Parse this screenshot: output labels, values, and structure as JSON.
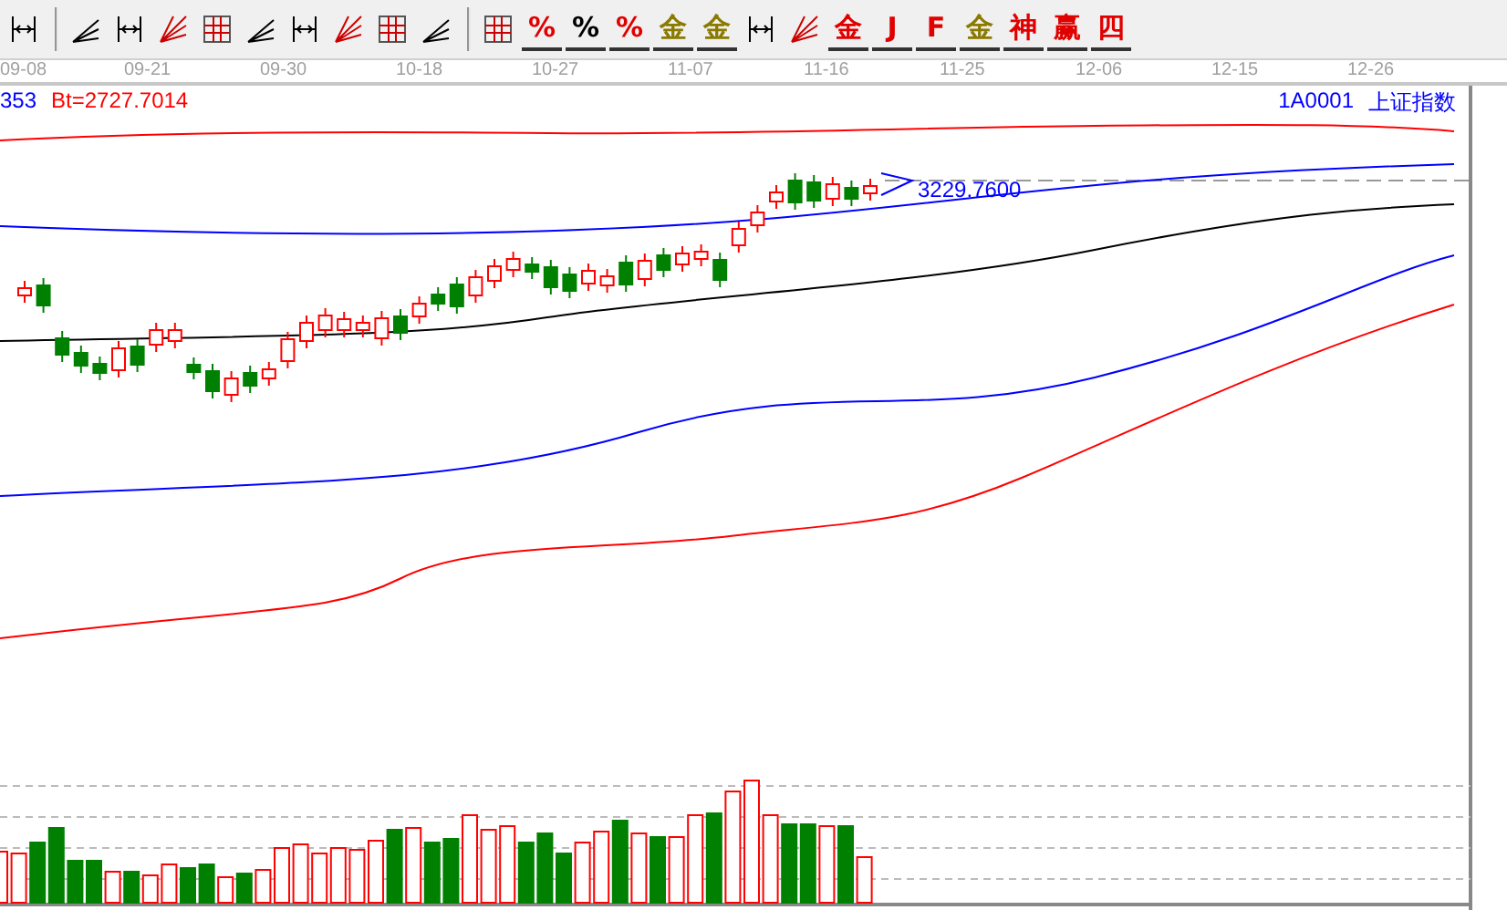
{
  "toolbar": {
    "groups": [
      [
        {
          "kind": "icon"
        }
      ],
      [
        {
          "kind": "icon"
        },
        {
          "kind": "icon"
        },
        {
          "kind": "icon"
        },
        {
          "kind": "icon"
        },
        {
          "kind": "icon"
        },
        {
          "kind": "icon"
        },
        {
          "kind": "icon"
        },
        {
          "kind": "icon"
        },
        {
          "kind": "icon"
        }
      ],
      [
        {
          "kind": "icon"
        },
        {
          "kind": "glyph",
          "text": "%",
          "color": "#e00000"
        },
        {
          "kind": "glyph",
          "text": "%",
          "color": "#000000"
        },
        {
          "kind": "glyph",
          "text": "%",
          "color": "#e00000"
        },
        {
          "kind": "glyph",
          "text": "金",
          "color": "#8a7a00"
        },
        {
          "kind": "glyph",
          "text": "金",
          "color": "#8a7a00"
        },
        {
          "kind": "icon"
        },
        {
          "kind": "icon"
        },
        {
          "kind": "glyph",
          "text": "金",
          "color": "#e00000"
        },
        {
          "kind": "glyph",
          "text": "J",
          "color": "#e00000"
        },
        {
          "kind": "glyph",
          "text": "F",
          "color": "#e00000"
        },
        {
          "kind": "glyph",
          "text": "金",
          "color": "#8a7a00"
        },
        {
          "kind": "glyph",
          "text": "神",
          "color": "#e00000"
        },
        {
          "kind": "glyph",
          "text": "赢",
          "color": "#e00000"
        },
        {
          "kind": "glyph",
          "text": "四",
          "color": "#e00000"
        }
      ]
    ]
  },
  "date_axis": {
    "labels": [
      "09-08",
      "09-21",
      "09-30",
      "10-18",
      "10-27",
      "11-07",
      "11-16",
      "11-25",
      "12-06",
      "12-15",
      "12-26"
    ]
  },
  "chart": {
    "readings": [
      {
        "text": "353",
        "color": "#0000ff"
      },
      {
        "text": "Bt=2727.7014",
        "color": "#ff0000"
      }
    ],
    "code": "1A0001",
    "name": "上证指数",
    "price_label": "3229.7600"
  }
}
